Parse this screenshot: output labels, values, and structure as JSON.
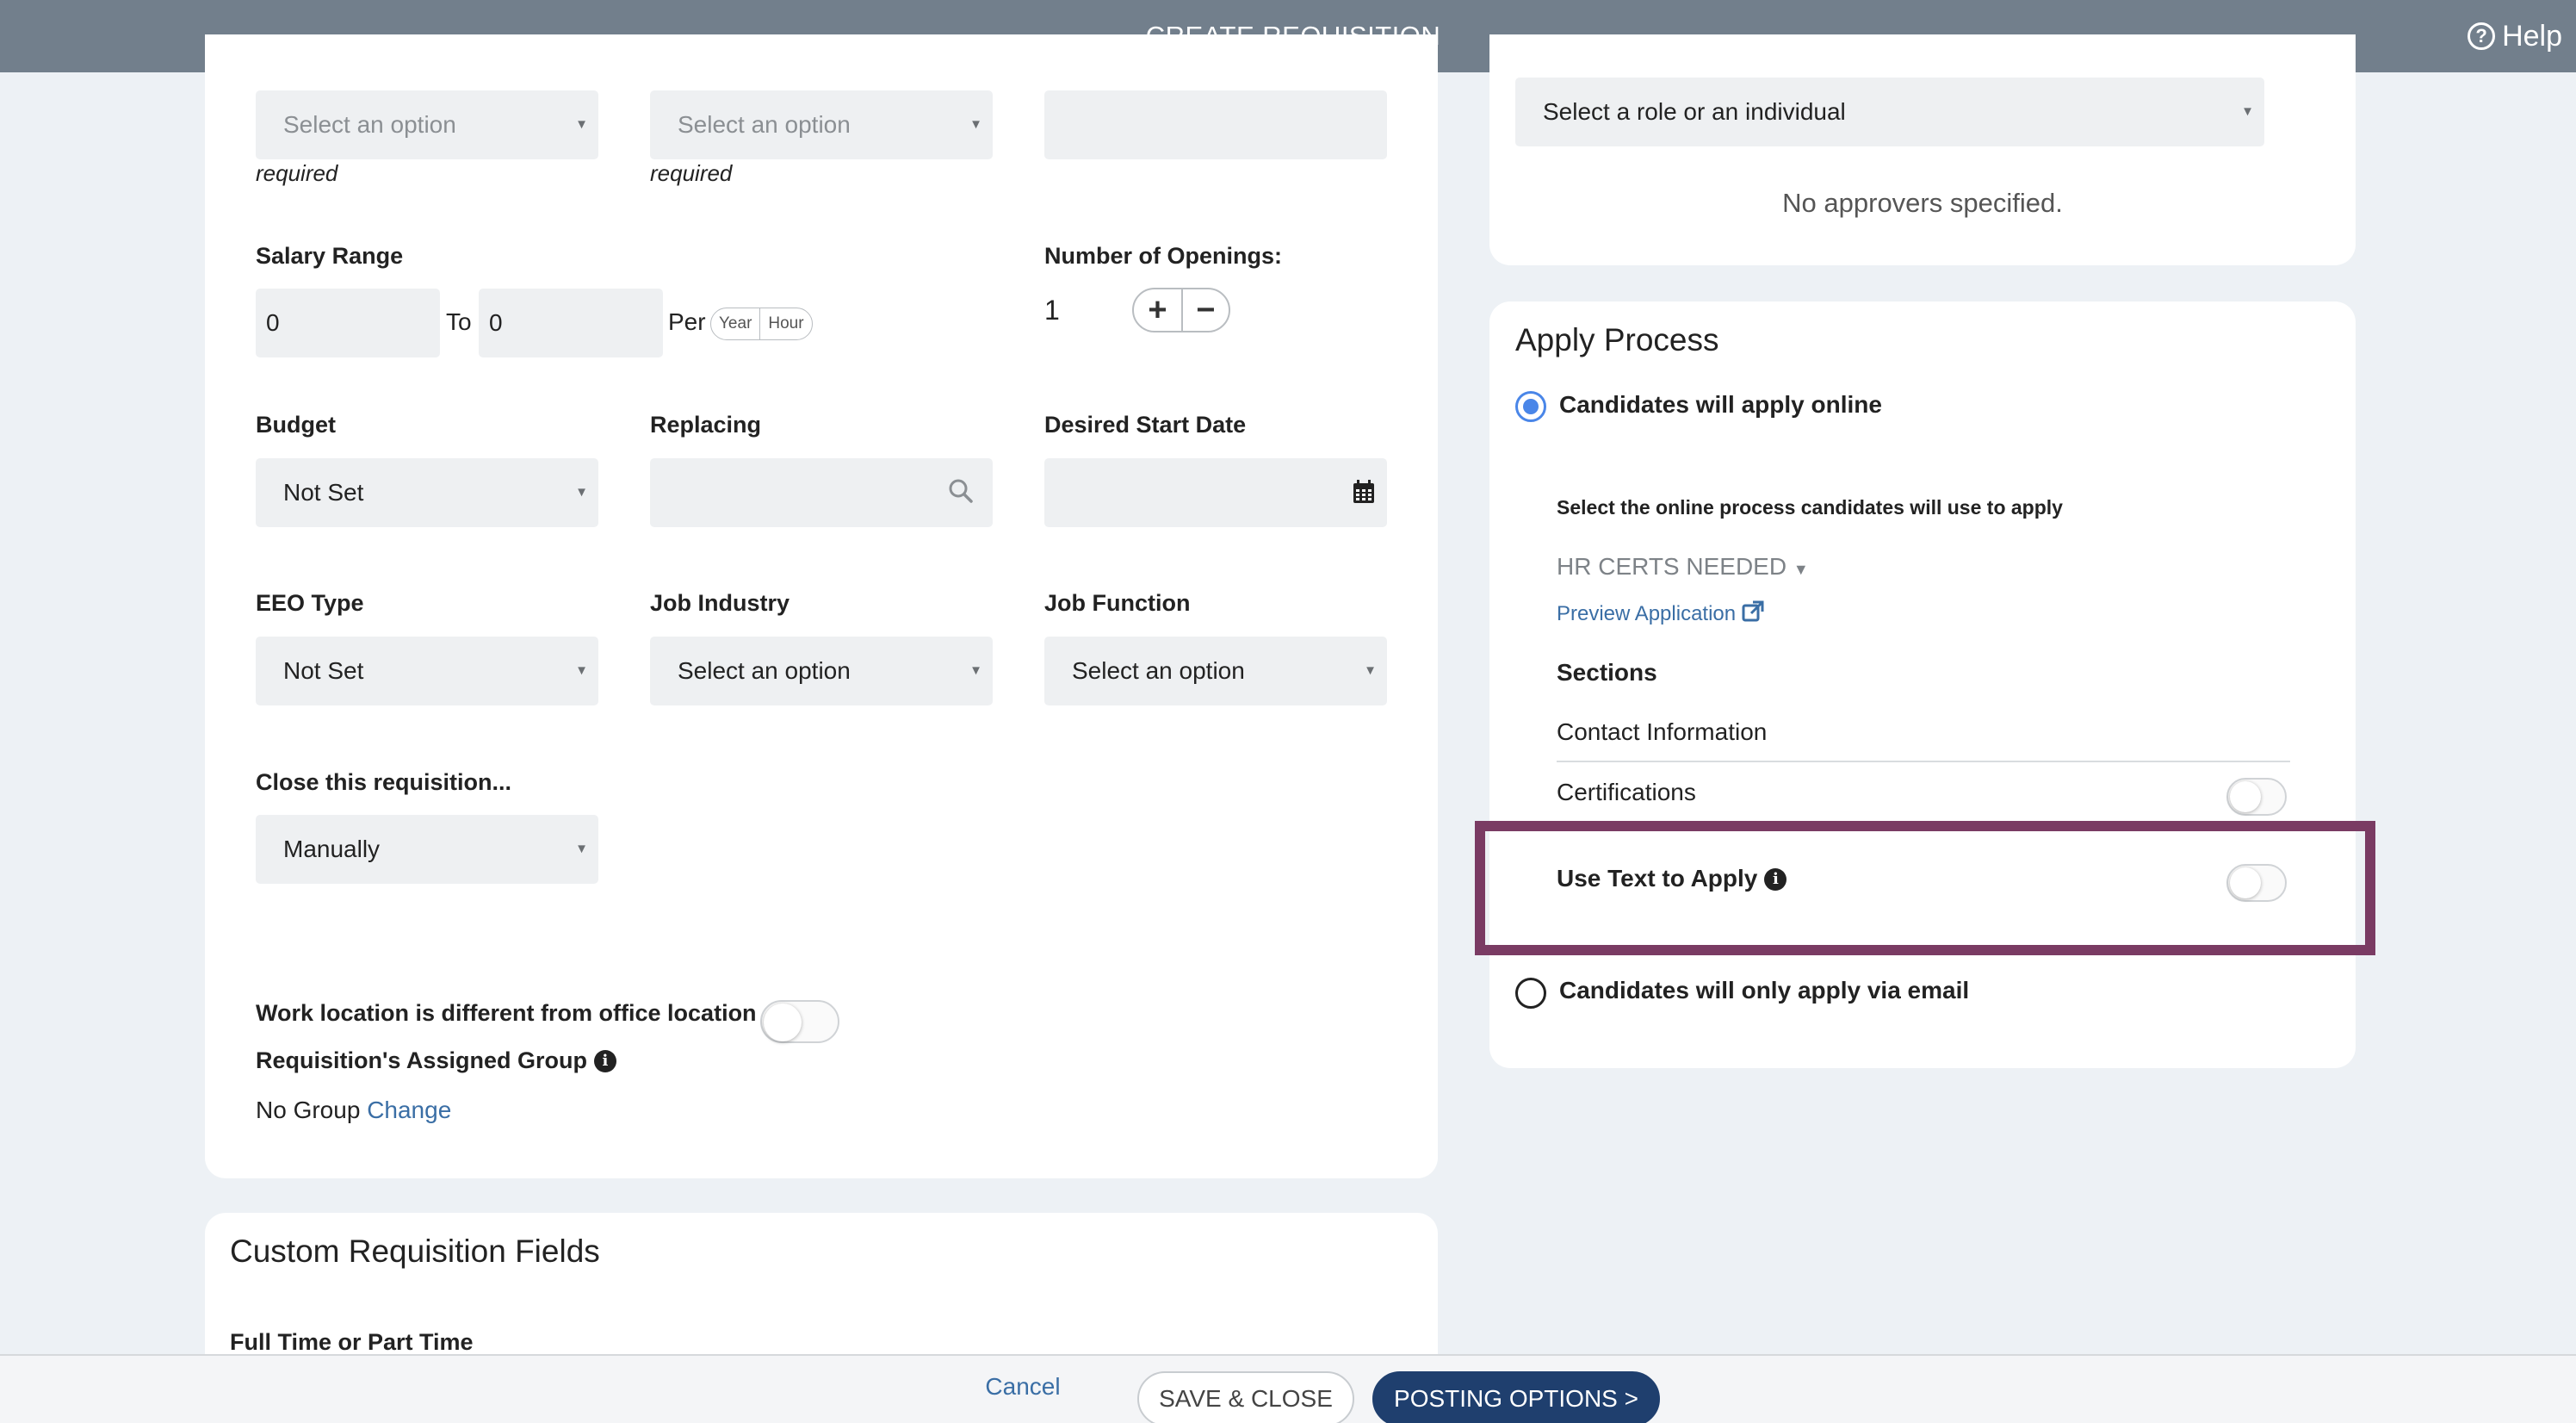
{
  "header": {
    "title": "CREATE REQUISITION",
    "help_label": "Help"
  },
  "form": {
    "top_row": [
      {
        "placeholder": "Select an option",
        "hint": "required"
      },
      {
        "placeholder": "Select an option",
        "hint": "required"
      },
      {
        "value": ""
      }
    ],
    "salary": {
      "label": "Salary Range",
      "from": "0",
      "to_label": "To",
      "to": "0",
      "per_label": "Per",
      "per_options": [
        "Year",
        "Hour"
      ]
    },
    "openings": {
      "label": "Number of Openings:",
      "value": "1",
      "plus": "+",
      "minus": "−"
    },
    "budget": {
      "label": "Budget",
      "value": "Not Set"
    },
    "replacing": {
      "label": "Replacing",
      "value": ""
    },
    "start_date": {
      "label": "Desired Start Date",
      "value": ""
    },
    "eeo": {
      "label": "EEO Type",
      "value": "Not Set"
    },
    "industry": {
      "label": "Job Industry",
      "value": "Select an option"
    },
    "function": {
      "label": "Job Function",
      "value": "Select an option"
    },
    "close": {
      "label": "Close this requisition...",
      "value": "Manually"
    },
    "work_location": {
      "label": "Work location is different from office location",
      "enabled": false
    },
    "assigned_group": {
      "label": "Requisition's Assigned Group",
      "value": "No Group",
      "change_link": "Change"
    }
  },
  "custom_fields": {
    "title": "Custom Requisition Fields",
    "first_field_label": "Full Time or Part Time"
  },
  "approvers": {
    "select_value": "Select a role or an individual",
    "empty_text": "No approvers specified."
  },
  "apply_process": {
    "title": "Apply Process",
    "online_option": "Candidates will apply online",
    "online_selected": true,
    "process_prompt": "Select the online process candidates will use to apply",
    "process_value": "HR CERTS NEEDED",
    "preview_link": "Preview Application",
    "sections_label": "Sections",
    "sections": [
      {
        "name": "Contact Information",
        "has_toggle": false
      },
      {
        "name": "Certifications",
        "has_toggle": true,
        "enabled": false
      }
    ],
    "text_to_apply": {
      "label": "Use Text to Apply",
      "enabled": false
    },
    "email_option": "Candidates will only apply via email"
  },
  "footer": {
    "cancel": "Cancel",
    "save_close": "SAVE & CLOSE",
    "posting_options": "POSTING OPTIONS >"
  },
  "colors": {
    "header": "#727f8c",
    "primary": "#1f3f6e",
    "link": "#3a6ea5",
    "radio": "#4a86e8",
    "highlight": "#7a3b63"
  }
}
